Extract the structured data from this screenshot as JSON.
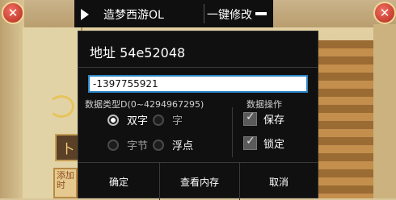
{
  "game": {
    "tile_text": "添加时",
    "side_icon": "卜"
  },
  "overlay": {
    "title": "造梦西游OL",
    "modify_label": "一键修改"
  },
  "dialog": {
    "title": "地址 54e52048",
    "value": "-1397755921",
    "type_label": "数据类型D(0~4294967295)",
    "ops_label": "数据操作",
    "types": [
      {
        "label": "双字",
        "selected": true
      },
      {
        "label": "字",
        "selected": false
      },
      {
        "label": "字节",
        "selected": false
      },
      {
        "label": "浮点",
        "selected": false
      }
    ],
    "ops": [
      {
        "label": "保存",
        "checked": true
      },
      {
        "label": "锁定",
        "checked": true
      }
    ],
    "buttons": {
      "confirm": "确定",
      "view_memory": "查看内存",
      "cancel": "取消"
    }
  },
  "colors": {
    "accent": "#2d86c8",
    "dialog_bg": "#101010",
    "close_red": "#b42a1e"
  }
}
